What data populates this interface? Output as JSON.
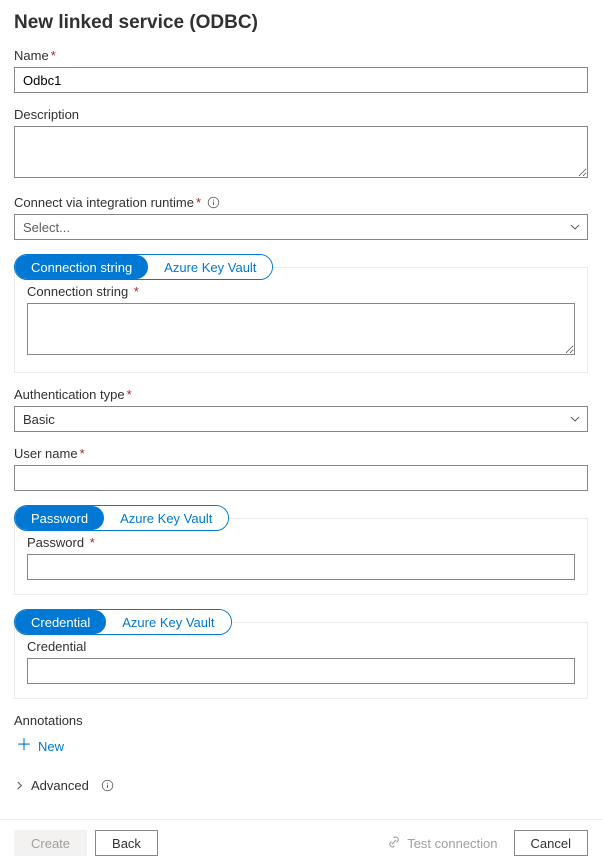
{
  "title": "New linked service (ODBC)",
  "fields": {
    "name": {
      "label": "Name",
      "value": "Odbc1",
      "required": true
    },
    "description": {
      "label": "Description",
      "value": ""
    },
    "runtime": {
      "label": "Connect via integration runtime",
      "required": true,
      "placeholder": "Select...",
      "value": ""
    },
    "conn_tabs": {
      "active": "Connection string",
      "other": "Azure Key Vault"
    },
    "connection_string": {
      "label": "Connection string",
      "required": true,
      "value": ""
    },
    "auth_type": {
      "label": "Authentication type",
      "required": true,
      "value": "Basic"
    },
    "username": {
      "label": "User name",
      "required": true,
      "value": ""
    },
    "pw_tabs": {
      "active": "Password",
      "other": "Azure Key Vault"
    },
    "password": {
      "label": "Password",
      "required": true,
      "value": ""
    },
    "cred_tabs": {
      "active": "Credential",
      "other": "Azure Key Vault"
    },
    "credential": {
      "label": "Credential",
      "value": ""
    },
    "annotations": {
      "label": "Annotations",
      "new": "New"
    },
    "advanced": {
      "label": "Advanced"
    }
  },
  "footer": {
    "create": "Create",
    "back": "Back",
    "test": "Test connection",
    "cancel": "Cancel"
  }
}
